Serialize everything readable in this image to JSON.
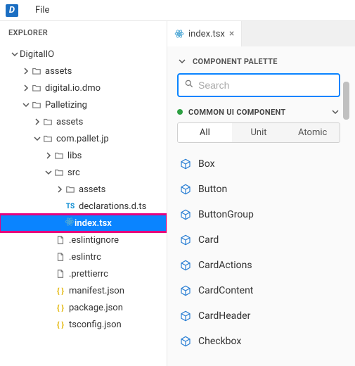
{
  "menu": {
    "file": "File"
  },
  "logo_letter": "D",
  "explorer": {
    "title": "EXPLORER",
    "tree": {
      "root": "DigitalIO",
      "assets": "assets",
      "dmo": "digital.io.dmo",
      "palletizing": "Palletizing",
      "p_assets": "assets",
      "com": "com.pallet.jp",
      "libs": "libs",
      "src": "src",
      "src_assets": "assets",
      "decl": "declarations.d.ts",
      "index_tsx": "index.tsx",
      "eslintignore": ".eslintignore",
      "eslintrc": ".eslintrc",
      "prettierrc": ".prettierrc",
      "manifest": "manifest.json",
      "package": "package.json",
      "tsconfig": "tsconfig.json"
    }
  },
  "tab": {
    "label": "index.tsx"
  },
  "palette": {
    "title": "COMPONENT PALETTE",
    "search_placeholder": "Search",
    "section": "COMMON UI COMPONENT",
    "seg": {
      "all": "All",
      "unit": "Unit",
      "atomic": "Atomic"
    },
    "items": [
      "Box",
      "Button",
      "ButtonGroup",
      "Card",
      "CardActions",
      "CardContent",
      "CardHeader",
      "Checkbox"
    ]
  }
}
